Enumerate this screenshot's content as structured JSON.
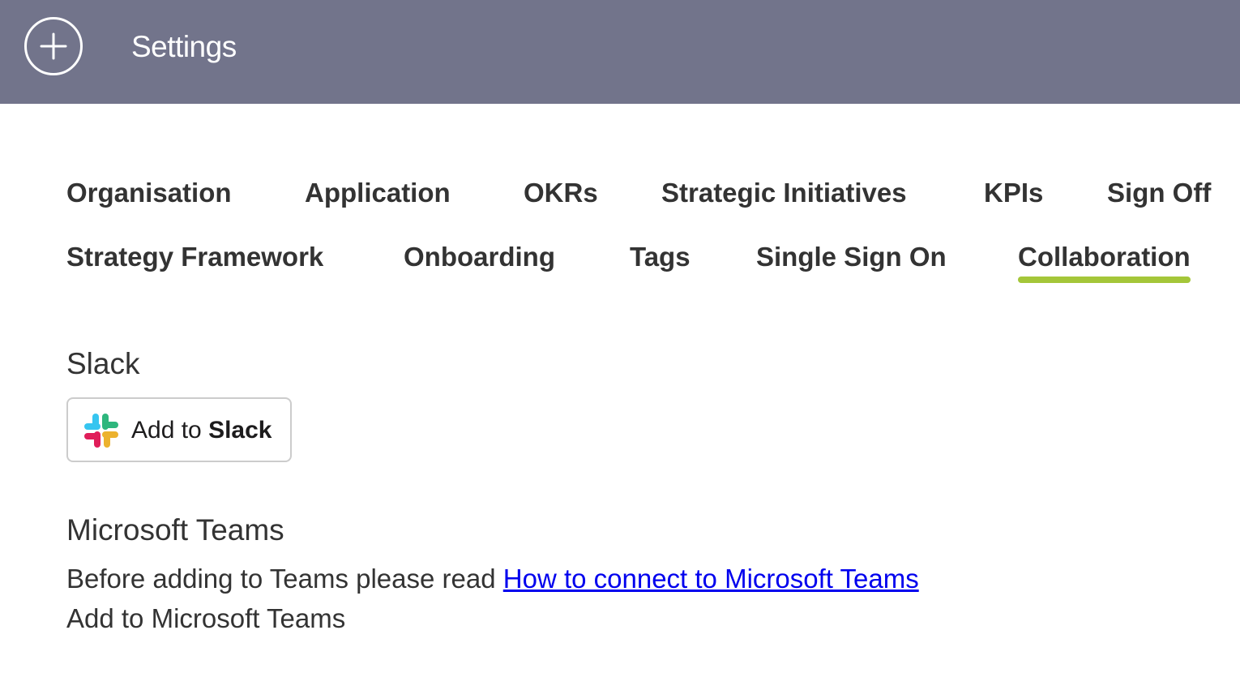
{
  "header": {
    "add_icon": "plus-circle-icon",
    "title": "Settings",
    "bg_color": "#72748b"
  },
  "tabs": [
    {
      "label": "Organisation"
    },
    {
      "label": "Application"
    },
    {
      "label": "OKRs"
    },
    {
      "label": "Strategic Initiatives"
    },
    {
      "label": "KPIs"
    },
    {
      "label": "Sign Off"
    },
    {
      "label": "Strategy Framework"
    },
    {
      "label": "Onboarding"
    },
    {
      "label": "Tags"
    },
    {
      "label": "Single Sign On"
    },
    {
      "label": "Collaboration",
      "active": true
    }
  ],
  "active_tab_underline_color": "#a4c639",
  "slack": {
    "heading": "Slack",
    "button_prefix": "Add to",
    "button_brand": "Slack",
    "icon": "slack-logo-icon"
  },
  "teams": {
    "heading": "Microsoft Teams",
    "intro_text": "Before adding to Teams please read",
    "link_text": "How to connect to Microsoft Teams",
    "add_text": "Add to Microsoft Teams"
  }
}
